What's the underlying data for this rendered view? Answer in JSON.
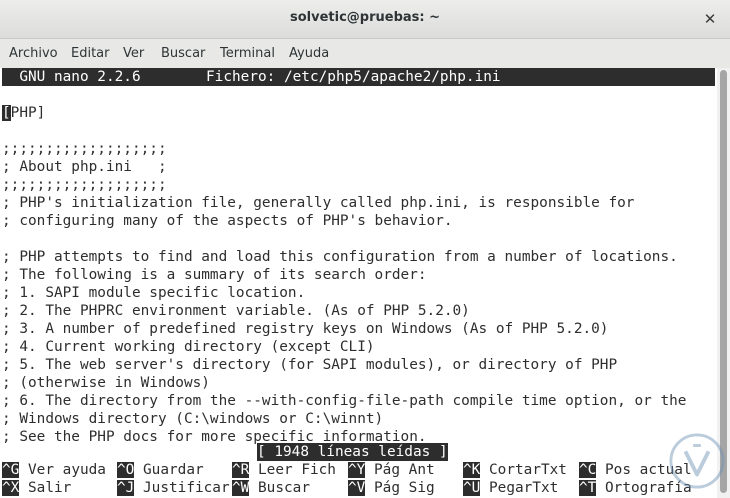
{
  "window": {
    "title": "solvetic@pruebas: ~",
    "close_glyph": "✕"
  },
  "menu": [
    "Archivo",
    "Editar",
    "Ver",
    "Buscar",
    "Terminal",
    "Ayuda"
  ],
  "nano": {
    "version": "  GNU nano 2.2.6",
    "file_label": "Fichero: /etc/php5/apache2/php.ini",
    "cursor_char": "[",
    "lines": [
      "PHP]",
      "",
      ";;;;;;;;;;;;;;;;;;;",
      "; About php.ini   ;",
      ";;;;;;;;;;;;;;;;;;;",
      "; PHP's initialization file, generally called php.ini, is responsible for",
      "; configuring many of the aspects of PHP's behavior.",
      "",
      "; PHP attempts to find and load this configuration from a number of locations.",
      "; The following is a summary of its search order:",
      "; 1. SAPI module specific location.",
      "; 2. The PHPRC environment variable. (As of PHP 5.2.0)",
      "; 3. A number of predefined registry keys on Windows (As of PHP 5.2.0)",
      "; 4. Current working directory (except CLI)",
      "; 5. The web server's directory (for SAPI modules), or directory of PHP",
      "; (otherwise in Windows)",
      "; 6. The directory from the --with-config-file-path compile time option, or the",
      "; Windows directory (C:\\windows or C:\\winnt)",
      "; See the PHP docs for more specific information."
    ],
    "status": "[ 1948 líneas leídas ]",
    "shortcuts_row1": [
      {
        "key": "^G",
        "label": "Ver ayuda"
      },
      {
        "key": "^O",
        "label": "Guardar"
      },
      {
        "key": "^R",
        "label": "Leer Fich"
      },
      {
        "key": "^Y",
        "label": "Pág Ant"
      },
      {
        "key": "^K",
        "label": "CortarTxt"
      },
      {
        "key": "^C",
        "label": "Pos actual"
      }
    ],
    "shortcuts_row2": [
      {
        "key": "^X",
        "label": "Salir"
      },
      {
        "key": "^J",
        "label": "Justificar"
      },
      {
        "key": "^W",
        "label": "Buscar"
      },
      {
        "key": "^V",
        "label": "Pág Sig"
      },
      {
        "key": "^U",
        "label": "PegarTxt"
      },
      {
        "key": "^T",
        "label": "Ortografía"
      }
    ]
  },
  "watermark_icon": "solvetic-logo-icon"
}
